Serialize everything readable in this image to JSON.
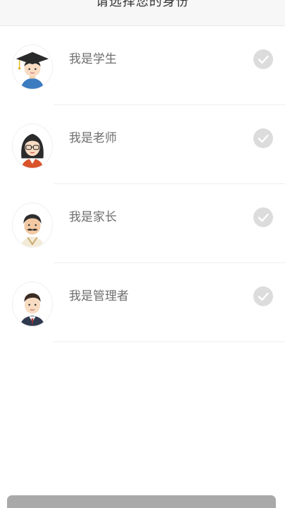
{
  "header": {
    "title": "请选择您的身份"
  },
  "roles": [
    {
      "label": "我是学生",
      "avatar_icon": "student-avatar-icon"
    },
    {
      "label": "我是老师",
      "avatar_icon": "teacher-avatar-icon"
    },
    {
      "label": "我是家长",
      "avatar_icon": "parent-avatar-icon"
    },
    {
      "label": "我是管理者",
      "avatar_icon": "manager-avatar-icon"
    }
  ],
  "colors": {
    "check_inactive": "#dcdcdc",
    "bottom_button": "#a9a9a9"
  }
}
